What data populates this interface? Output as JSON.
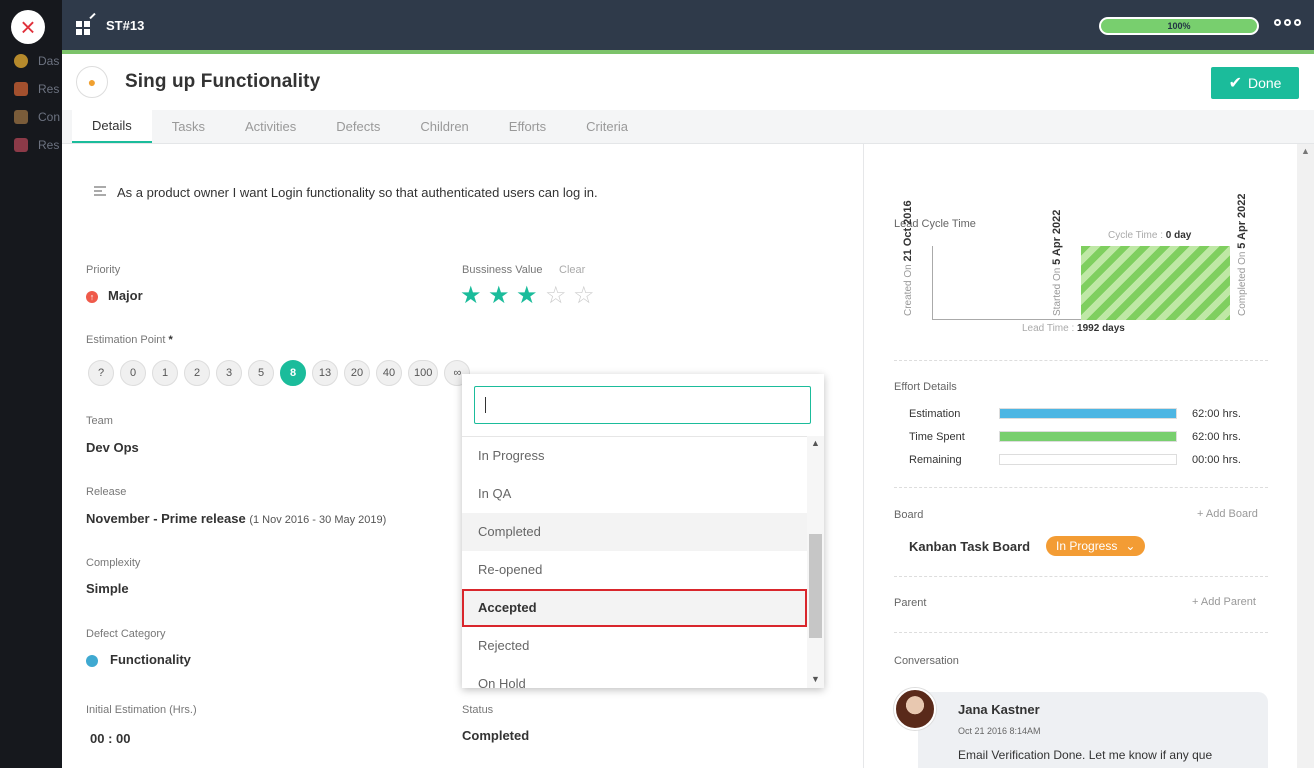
{
  "backdrop": {
    "items": [
      "Das",
      "Res",
      "Con",
      "Res"
    ]
  },
  "close_icon": "×",
  "topbar": {
    "ticket_id": "ST#13",
    "progress_label": "100%",
    "progress_fraction": 1.0
  },
  "header": {
    "title": "Sing up Functionality",
    "done_label": "Done",
    "done_icon": "✔"
  },
  "tabs": [
    {
      "label": "Details",
      "active": true
    },
    {
      "label": "Tasks"
    },
    {
      "label": "Activities"
    },
    {
      "label": "Defects"
    },
    {
      "label": "Children"
    },
    {
      "label": "Efforts"
    },
    {
      "label": "Criteria"
    }
  ],
  "details": {
    "description": "As a product owner I want Login functionality so that authenticated users can log in.",
    "priority": {
      "label": "Priority",
      "value": "Major"
    },
    "business_value": {
      "label": "Bussiness Value",
      "clear": "Clear",
      "rating": 3,
      "max": 5
    },
    "estimation": {
      "label": "Estimation Point",
      "required_mark": "*",
      "points": [
        "?",
        "0",
        "1",
        "2",
        "3",
        "5",
        "8",
        "13",
        "20",
        "40",
        "100",
        "∞"
      ],
      "selected": "8"
    },
    "team": {
      "label": "Team",
      "value": "Dev Ops"
    },
    "release": {
      "label": "Release",
      "value": "November - Prime release",
      "range": "(1 Nov 2016 - 30 May 2019)"
    },
    "complexity": {
      "label": "Complexity",
      "value": "Simple"
    },
    "defect_category": {
      "label": "Defect Category",
      "value": "Functionality"
    },
    "initial_estimation": {
      "label": "Initial Estimation (Hrs.)",
      "value": "00 : 00"
    },
    "status": {
      "label": "Status",
      "value": "Completed"
    }
  },
  "dropdown": {
    "search_value": "",
    "options": [
      "In Progress",
      "In QA",
      "Completed",
      "Re-opened",
      "Accepted",
      "Rejected",
      "On Hold"
    ],
    "hover": "Completed",
    "selected": "Accepted"
  },
  "right": {
    "lead_cycle": {
      "label": "Lead Cycle Time",
      "created_label": "Created On",
      "created_date": "21 Oct 2016",
      "started_label": "Started On",
      "started_date": "5 Apr 2022",
      "completed_label": "Completed On",
      "completed_date": "5 Apr 2022",
      "cycle_label": "Cycle Time :",
      "cycle_value": "0 day",
      "lead_label": "Lead Time :",
      "lead_value": "1992 days"
    },
    "effort": {
      "label": "Effort Details",
      "rows": [
        {
          "name": "Estimation",
          "value": "62:00 hrs.",
          "fill": 1.0,
          "color": "#4db6e3"
        },
        {
          "name": "Time Spent",
          "value": "62:00 hrs.",
          "fill": 1.0,
          "color": "#78cf6e"
        },
        {
          "name": "Remaining",
          "value": "00:00 hrs.",
          "fill": 0.0,
          "color": "#ffffff"
        }
      ]
    },
    "board": {
      "label": "Board",
      "add_label": "Add Board",
      "name": "Kanban Task Board",
      "status": "In Progress"
    },
    "parent": {
      "label": "Parent",
      "add_label": "Add Parent"
    },
    "conversation": {
      "label": "Conversation",
      "author": "Jana Kastner",
      "time": "Oct 21 2016 8:14AM",
      "text": "Email Verification Done. Let me know if any que"
    }
  }
}
